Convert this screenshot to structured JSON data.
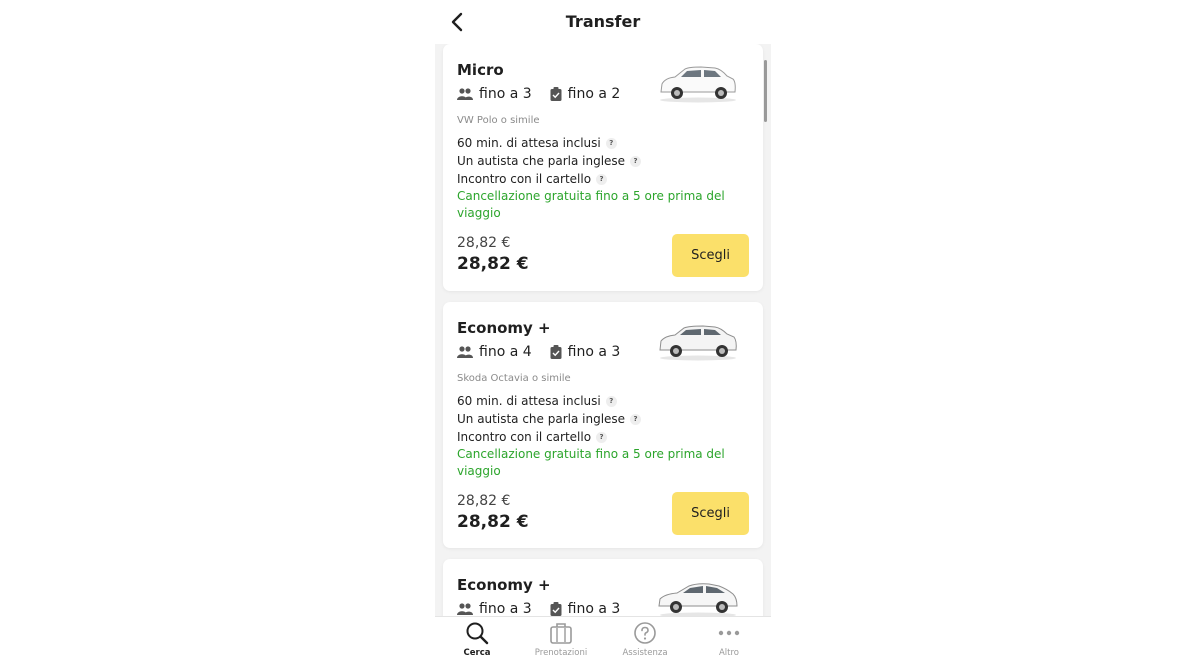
{
  "header": {
    "title": "Transfer"
  },
  "cards": [
    {
      "name": "Micro",
      "passengers": "fino a 3",
      "luggage": "fino a 2",
      "model": "VW Polo o simile",
      "features": [
        "60 min. di attesa inclusi",
        "Un autista che parla inglese",
        "Incontro con il cartello"
      ],
      "help_mark": "?",
      "cancellation": "Cancellazione gratuita fino a 5 ore prima del viaggio",
      "price_old": "28,82 €",
      "price": "28,82 €",
      "button_label": "Scegli"
    },
    {
      "name": "Economy +",
      "passengers": "fino a 4",
      "luggage": "fino a 3",
      "model": "Skoda Octavia o simile",
      "features": [
        "60 min. di attesa inclusi",
        "Un autista che parla inglese",
        "Incontro con il cartello"
      ],
      "help_mark": "?",
      "cancellation": "Cancellazione gratuita fino a 5 ore prima del viaggio",
      "price_old": "28,82 €",
      "price": "28,82 €",
      "button_label": "Scegli"
    },
    {
      "name": "Economy +",
      "passengers": "fino a 3",
      "luggage": "fino a 3"
    }
  ],
  "tabs": [
    {
      "label": "Cerca",
      "icon": "search-icon",
      "active": true
    },
    {
      "label": "Prenotazioni",
      "icon": "suitcase-icon",
      "active": false
    },
    {
      "label": "Assistenza",
      "icon": "help-icon",
      "active": false
    },
    {
      "label": "Altro",
      "icon": "more-icon",
      "active": false
    }
  ],
  "colors": {
    "accent_button": "#fbe06a",
    "cancellation_text": "#2ca52c",
    "background": "#f3f3f3"
  }
}
